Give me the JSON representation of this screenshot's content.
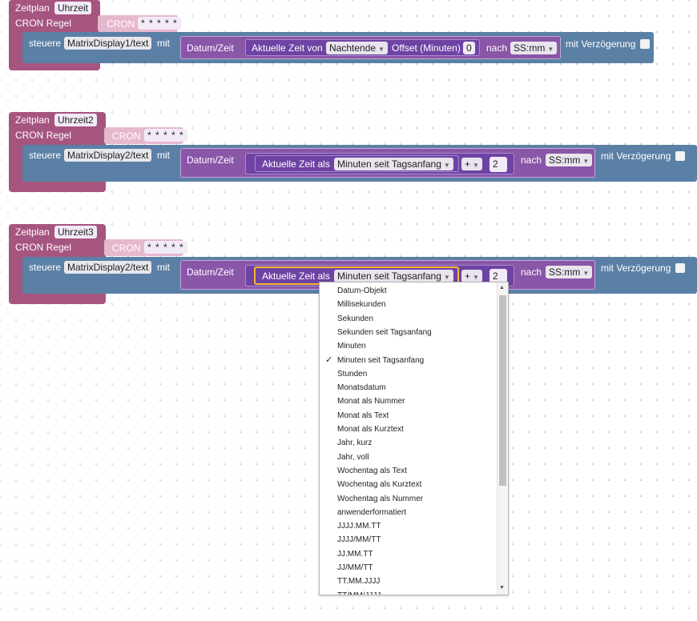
{
  "blocks": [
    {
      "schedule_label": "Zeitplan",
      "schedule_name": "Uhrzeit",
      "cron_rule_label": "CRON Regel",
      "cron_label": "CRON",
      "cron_value": "* * * * *",
      "control_label": "steuere",
      "control_target": "MatrixDisplay1/text",
      "with_label": "mit",
      "datetime_label": "Datum/Zeit",
      "current_time_label": "Aktuelle Zeit von",
      "current_time_option": "Nachtende",
      "offset_label": "Offset (Minuten)",
      "offset_value": "0",
      "to_label": "nach",
      "format_value": "SS:mm",
      "delay_label": "mit Verzögerung"
    },
    {
      "schedule_label": "Zeitplan",
      "schedule_name": "Uhrzeit2",
      "cron_rule_label": "CRON Regel",
      "cron_label": "CRON",
      "cron_value": "* * * * *",
      "control_label": "steuere",
      "control_target": "MatrixDisplay2/text",
      "with_label": "mit",
      "datetime_label": "Datum/Zeit",
      "current_time_label": "Aktuelle Zeit als",
      "current_time_option": "Minuten seit Tagsanfang",
      "operator": "+",
      "operand": "2",
      "to_label": "nach",
      "format_value": "SS:mm",
      "delay_label": "mit Verzögerung"
    },
    {
      "schedule_label": "Zeitplan",
      "schedule_name": "Uhrzeit3",
      "cron_rule_label": "CRON Regel",
      "cron_label": "CRON",
      "cron_value": "* * * * *",
      "control_label": "steuere",
      "control_target": "MatrixDisplay2/text",
      "with_label": "mit",
      "datetime_label": "Datum/Zeit",
      "current_time_label": "Aktuelle Zeit als",
      "current_time_option": "Minuten seit Tagsanfang",
      "operator": "+",
      "operand": "2",
      "to_label": "nach",
      "format_value": "SS:mm",
      "delay_label": "mit Verzögerung"
    }
  ],
  "dropdown": {
    "selected": "Minuten seit Tagsanfang",
    "check_mark": "✓",
    "options": [
      "Datum-Objekt",
      "Millisekunden",
      "Sekunden",
      "Sekunden seit Tagsanfang",
      "Minuten",
      "Minuten seit Tagsanfang",
      "Stunden",
      "Monatsdatum",
      "Monat als Nummer",
      "Monat als Text",
      "Monat als Kurztext",
      "Jahr, kurz",
      "Jahr, voll",
      "Wochentag als Text",
      "Wochentag als Kurztext",
      "Wochentag als Nummer",
      "anwenderformatiert",
      "JJJJ.MM.TT",
      "JJJJ/MM/TT",
      "JJ.MM.TT",
      "JJ/MM/TT",
      "TT.MM.JJJJ",
      "TT/MM/JJJJ"
    ]
  },
  "icons": {
    "dropdown_arrow": "chevron-down-icon",
    "scroll_up": "scroll-up-arrow-icon",
    "scroll_down": "scroll-down-arrow-icon"
  },
  "colors": {
    "schedule_block": "#a5557f",
    "cron_block": "#e6b8ce",
    "control_block": "#5b80a5",
    "datetime_block": "#8a56a8",
    "selected_outline": "#f5b82e"
  }
}
